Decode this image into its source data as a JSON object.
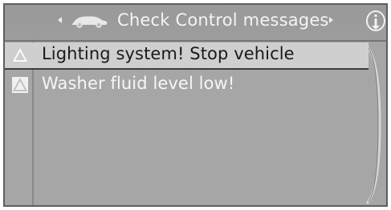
{
  "header": {
    "title": "Check Control messages",
    "left_arrow_icon": "arrow-left-icon",
    "right_arrow_icon": "arrow-right-icon",
    "vehicle_icon": "car-icon",
    "info_icon": "info-icon"
  },
  "messages": [
    {
      "text": "Lighting system! Stop vehicle",
      "icon": "warning-triangle-icon",
      "selected": true
    },
    {
      "text": "Washer fluid level low!",
      "icon": "warning-triangle-icon",
      "selected": false
    }
  ],
  "colors": {
    "panel_bg": "#a6a6a6",
    "selected_row_bg": "#cfcfcf",
    "text_light": "#f6f6f6",
    "text_dark": "#1a1a1a"
  }
}
